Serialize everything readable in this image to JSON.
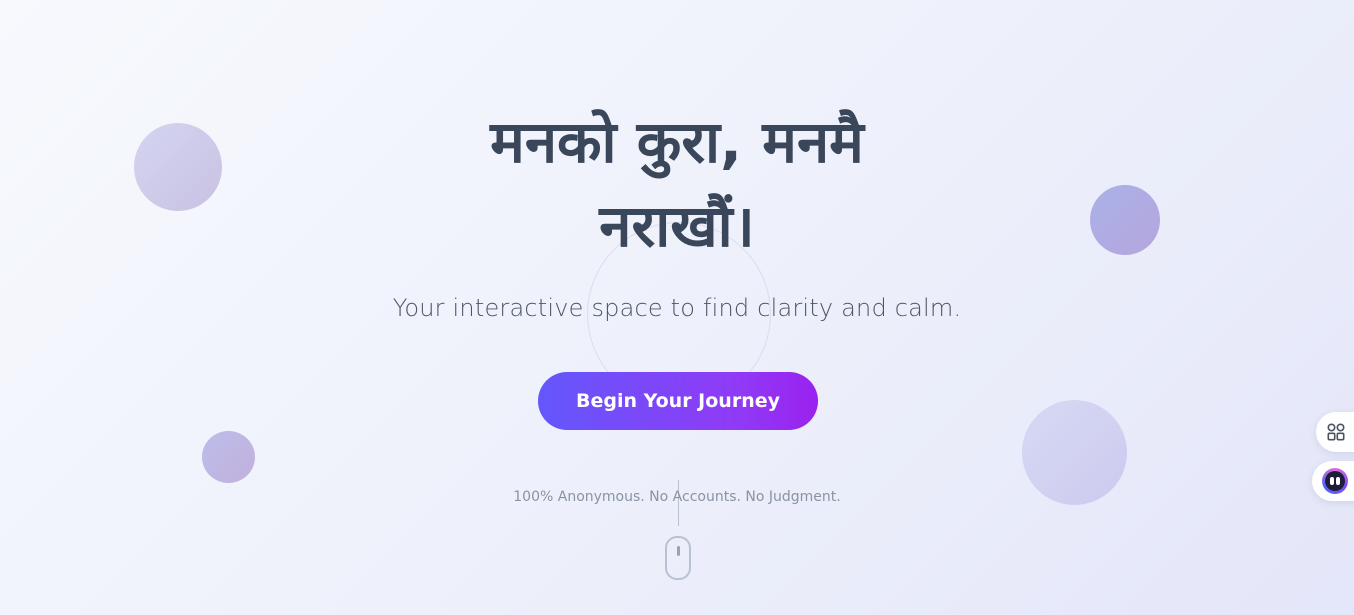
{
  "hero": {
    "title": "मनको कुरा, मनमै नराखौं।",
    "subtitle": "Your interactive space to find clarity and calm.",
    "cta_label": "Begin Your Journey",
    "note": "100% Anonymous. No Accounts. No Judgment."
  },
  "floating_actions": {
    "apps_icon": "grid-icon",
    "assistant_icon": "assistant-face-icon"
  },
  "colors": {
    "title": "#3a4659",
    "cta_gradient_start": "#6457fb",
    "cta_gradient_end": "#9a22ef",
    "background": "#eef1fb"
  }
}
